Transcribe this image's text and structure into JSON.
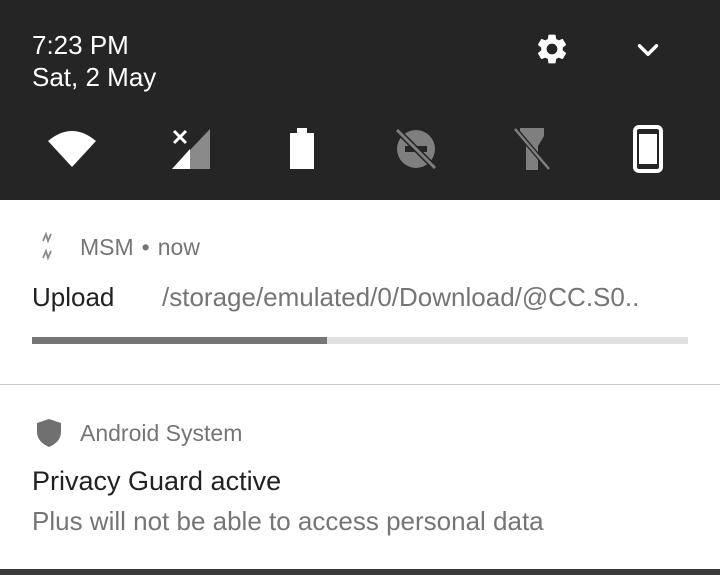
{
  "status": {
    "time": "7:23 PM",
    "date": "Sat, 2 May"
  },
  "header_icons": [
    "gear-icon",
    "chevron-down-icon"
  ],
  "quick_settings": [
    {
      "name": "wifi",
      "icon": "wifi-icon"
    },
    {
      "name": "mobile-data",
      "icon": "cellular-no-signal-icon"
    },
    {
      "name": "battery",
      "icon": "battery-icon"
    },
    {
      "name": "do-not-disturb",
      "icon": "dnd-off-icon"
    },
    {
      "name": "flashlight",
      "icon": "flashlight-off-icon"
    },
    {
      "name": "auto-rotate",
      "icon": "portrait-phone-icon"
    }
  ],
  "notifications": [
    {
      "app": "MSM",
      "separator": "•",
      "when": "now",
      "title": "Upload",
      "text": "/storage/emulated/0/Download/@CC.S0..",
      "progress": 0.45
    },
    {
      "app": "Android System",
      "title": "Privacy Guard active",
      "text": "Plus will not be able to access personal data"
    }
  ],
  "colors": {
    "shade": "#252525",
    "progress_fill": "#757575",
    "progress_track": "#e0e0e0"
  }
}
